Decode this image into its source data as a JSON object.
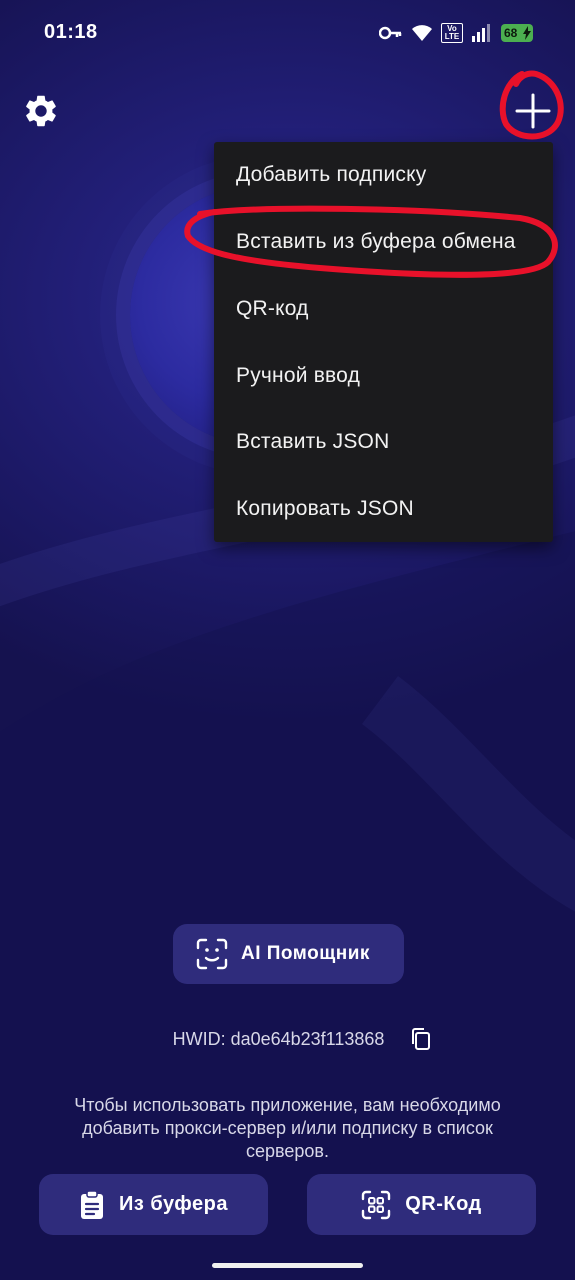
{
  "status_bar": {
    "time": "01:18",
    "volte": "Vo LTE",
    "battery": "68"
  },
  "toolbar": {
    "settings_icon": "gear-icon",
    "add_icon": "plus-icon"
  },
  "menu": {
    "items": [
      {
        "label": "Добавить подписку"
      },
      {
        "label": "Вставить из буфера обмена"
      },
      {
        "label": "QR-код"
      },
      {
        "label": "Ручной ввод"
      },
      {
        "label": "Вставить JSON"
      },
      {
        "label": "Копировать JSON"
      }
    ]
  },
  "ai_assistant": {
    "label": "AI Помощник",
    "icon": "face-scan-icon"
  },
  "hwid": {
    "text": "HWID: da0e64b23f113868",
    "copy_icon": "copy-icon"
  },
  "hint": "Чтобы использовать приложение, вам необходимо добавить прокси-сервер и/или подписку в список серверов.",
  "bottom_buttons": {
    "clipboard_label": "Из буфера",
    "qr_label": "QR-Код"
  },
  "colors": {
    "background": "#1f1c6e",
    "menu_bg": "#1b1b1d",
    "button_bg": "#2f2c7c",
    "annotation": "#e8112a"
  }
}
